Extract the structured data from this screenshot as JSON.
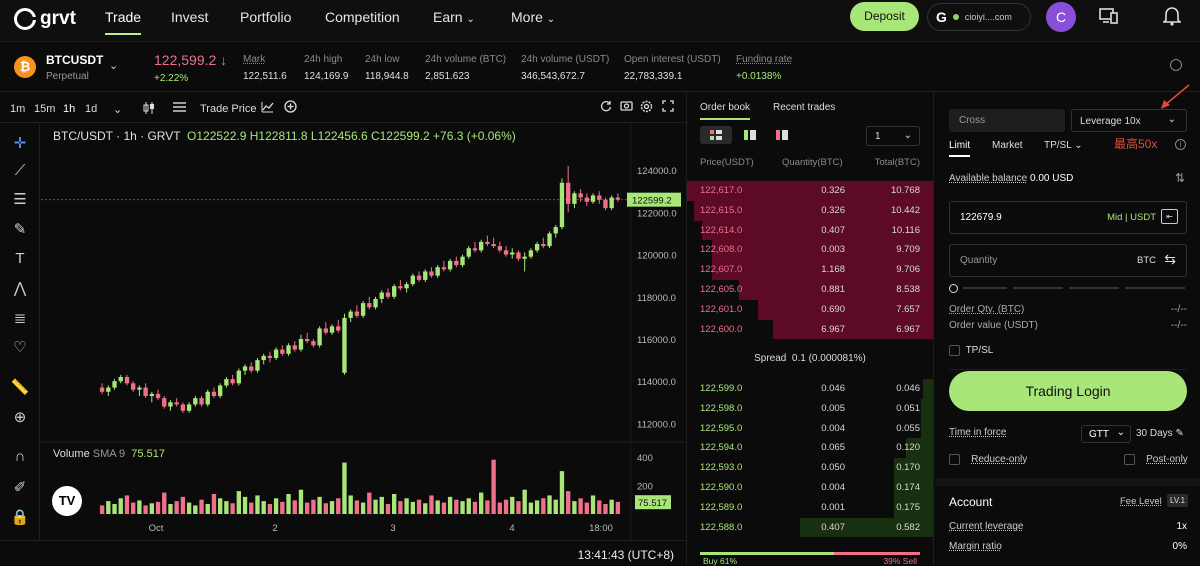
{
  "nav": {
    "logo": "grvt",
    "items": [
      "Trade",
      "Invest",
      "Portfolio",
      "Competition",
      "Earn",
      "More"
    ],
    "deposit": "Deposit",
    "wallet_label": "cioiyi....com",
    "avatar_letter": "C"
  },
  "ticker": {
    "symbol": "BTCUSDT",
    "type": "Perpetual",
    "price": "122,599.2 ↓",
    "change": "+2.22%",
    "stats": [
      {
        "label": "Mark",
        "value": "122,511.6"
      },
      {
        "label": "24h high",
        "value": "124,169.9"
      },
      {
        "label": "24h low",
        "value": "118,944.8"
      },
      {
        "label": "24h volume (BTC)",
        "value": "2,851.623"
      },
      {
        "label": "24h volume (USDT)",
        "value": "346,543,672.7"
      },
      {
        "label": "Open interest (USDT)",
        "value": "22,783,339.1"
      },
      {
        "label": "Funding rate",
        "value": "+0.0138%"
      }
    ]
  },
  "chart_toolbar": {
    "intervals": [
      "1m",
      "15m",
      "1h",
      "1d"
    ],
    "trade_price": "Trade Price"
  },
  "chart": {
    "pair_title": "BTC/USDT · 1h · GRVT",
    "ohlc": "O122522.9  H122811.8  L122456.6  C122599.2  +76.3 (+0.06%)",
    "price_ticks": [
      "124000.0",
      "122000.0",
      "120000.0",
      "118000.0",
      "116000.0",
      "114000.0",
      "112000.0"
    ],
    "last_price_label": "122599.2",
    "volume_title": "Volume",
    "volume_sma": "SMA 9",
    "volume_value": "75.517",
    "volume_ticks": [
      "400",
      "200"
    ],
    "x_ticks": [
      "Oct",
      "2",
      "3",
      "4",
      "18:00"
    ],
    "clock": "13:41:43 (UTC+8)"
  },
  "chart_data": {
    "type": "candlestick",
    "x_ticks": [
      "Oct",
      "2",
      "3",
      "4",
      "18:00"
    ],
    "ylim": [
      111500,
      125000
    ],
    "candles": [
      [
        113700,
        113900,
        113400,
        113500
      ],
      [
        113500,
        113800,
        113300,
        113700
      ],
      [
        113700,
        114100,
        113600,
        114000
      ],
      [
        114000,
        114300,
        113900,
        114200
      ],
      [
        114200,
        114300,
        113800,
        113900
      ],
      [
        113900,
        114000,
        113500,
        113600
      ],
      [
        113600,
        113800,
        113300,
        113700
      ],
      [
        113700,
        113900,
        113200,
        113300
      ],
      [
        113300,
        113500,
        113000,
        113400
      ],
      [
        113400,
        113600,
        113100,
        113200
      ],
      [
        113200,
        113300,
        112700,
        112800
      ],
      [
        112800,
        113100,
        112600,
        113000
      ],
      [
        113000,
        113200,
        112800,
        112900
      ],
      [
        112900,
        113000,
        112500,
        112600
      ],
      [
        112600,
        113000,
        112500,
        112900
      ],
      [
        112900,
        113300,
        112800,
        113200
      ],
      [
        113200,
        113300,
        112800,
        112900
      ],
      [
        112900,
        113600,
        112800,
        113500
      ],
      [
        113500,
        113700,
        113200,
        113300
      ],
      [
        113300,
        113900,
        113200,
        113800
      ],
      [
        113800,
        114200,
        113700,
        114100
      ],
      [
        114100,
        114300,
        113800,
        113900
      ],
      [
        113900,
        114600,
        113800,
        114500
      ],
      [
        114500,
        114800,
        114300,
        114700
      ],
      [
        114700,
        114900,
        114400,
        114500
      ],
      [
        114500,
        115100,
        114400,
        115000
      ],
      [
        115000,
        115300,
        114800,
        115200
      ],
      [
        115200,
        115400,
        114900,
        115100
      ],
      [
        115100,
        115600,
        115000,
        115500
      ],
      [
        115500,
        115700,
        115200,
        115300
      ],
      [
        115300,
        115800,
        115200,
        115700
      ],
      [
        115700,
        115900,
        115400,
        115500
      ],
      [
        115500,
        116200,
        115400,
        116000
      ],
      [
        116000,
        116300,
        115800,
        115900
      ],
      [
        115900,
        116000,
        115600,
        115700
      ],
      [
        115700,
        116600,
        115600,
        116500
      ],
      [
        116500,
        116800,
        116200,
        116300
      ],
      [
        116300,
        116700,
        116200,
        116600
      ],
      [
        116600,
        116900,
        116300,
        116400
      ],
      [
        114400,
        117200,
        114300,
        117000
      ],
      [
        117000,
        117400,
        116800,
        117300
      ],
      [
        117300,
        117600,
        117000,
        117100
      ],
      [
        117100,
        117800,
        117000,
        117700
      ],
      [
        117700,
        118000,
        117400,
        117500
      ],
      [
        117500,
        118000,
        117400,
        117900
      ],
      [
        117900,
        118300,
        117700,
        118200
      ],
      [
        118200,
        118400,
        117900,
        118000
      ],
      [
        118000,
        118600,
        117900,
        118500
      ],
      [
        118500,
        118800,
        118300,
        118400
      ],
      [
        118400,
        118700,
        118200,
        118600
      ],
      [
        118600,
        119100,
        118500,
        119000
      ],
      [
        119000,
        119200,
        118700,
        118800
      ],
      [
        118800,
        119300,
        118700,
        119200
      ],
      [
        119200,
        119400,
        118900,
        119000
      ],
      [
        119000,
        119500,
        118900,
        119400
      ],
      [
        119400,
        119700,
        119200,
        119300
      ],
      [
        119300,
        119800,
        119200,
        119700
      ],
      [
        119700,
        119900,
        119400,
        119500
      ],
      [
        119500,
        120000,
        119400,
        119900
      ],
      [
        119900,
        120400,
        119800,
        120300
      ],
      [
        120300,
        120600,
        120100,
        120200
      ],
      [
        120200,
        120700,
        120100,
        120600
      ],
      [
        120600,
        120900,
        120400,
        120500
      ],
      [
        120500,
        120800,
        120300,
        120400
      ],
      [
        120400,
        120600,
        120100,
        120200
      ],
      [
        120200,
        120400,
        119900,
        120000
      ],
      [
        120000,
        120300,
        119800,
        120100
      ],
      [
        120100,
        120200,
        119700,
        119800
      ],
      [
        119800,
        120100,
        119200,
        119900
      ],
      [
        119900,
        120300,
        119800,
        120200
      ],
      [
        120200,
        120600,
        120100,
        120500
      ],
      [
        120500,
        120800,
        120300,
        120400
      ],
      [
        120400,
        121100,
        120300,
        121000
      ],
      [
        121000,
        121400,
        120800,
        121300
      ],
      [
        121300,
        123600,
        121200,
        123400
      ],
      [
        123400,
        124200,
        122000,
        122400
      ],
      [
        122400,
        123000,
        122200,
        122900
      ],
      [
        122900,
        123100,
        122500,
        122700
      ],
      [
        122700,
        122900,
        122300,
        122500
      ],
      [
        122500,
        122900,
        122400,
        122800
      ],
      [
        122800,
        123000,
        122400,
        122600
      ],
      [
        122600,
        122700,
        122100,
        122200
      ],
      [
        122200,
        122800,
        122100,
        122700
      ],
      [
        122700,
        122900,
        122500,
        122600
      ]
    ],
    "volume": [
      60,
      90,
      70,
      110,
      130,
      80,
      95,
      60,
      75,
      85,
      150,
      70,
      90,
      120,
      80,
      60,
      100,
      70,
      140,
      110,
      90,
      75,
      160,
      120,
      80,
      130,
      90,
      70,
      110,
      85,
      140,
      95,
      170,
      80,
      100,
      120,
      75,
      90,
      110,
      360,
      130,
      95,
      80,
      150,
      100,
      120,
      70,
      140,
      90,
      110,
      85,
      100,
      75,
      130,
      95,
      80,
      120,
      100,
      90,
      110,
      85,
      150,
      95,
      380,
      80,
      100,
      120,
      90,
      170,
      80,
      95,
      110,
      130,
      100,
      300,
      160,
      90,
      110,
      80,
      130,
      95,
      70,
      100,
      85
    ]
  },
  "orderbook": {
    "tabs": [
      "Order book",
      "Recent trades"
    ],
    "step": "1",
    "headers": [
      "Price(USDT)",
      "Quantity(BTC)",
      "Total(BTC)"
    ],
    "asks": [
      {
        "p": "122,617.0",
        "q": "0.326",
        "t": "10.768",
        "depth": 1.0
      },
      {
        "p": "122,615.0",
        "q": "0.326",
        "t": "10.442",
        "depth": 0.97
      },
      {
        "p": "122,614.0",
        "q": "0.407",
        "t": "10.116",
        "depth": 0.94
      },
      {
        "p": "122,608.0",
        "q": "0.003",
        "t": "9.709",
        "depth": 0.9
      },
      {
        "p": "122,607.0",
        "q": "1.168",
        "t": "9.706",
        "depth": 0.9
      },
      {
        "p": "122,605.0",
        "q": "0.881",
        "t": "8.538",
        "depth": 0.79
      },
      {
        "p": "122,601.0",
        "q": "0.690",
        "t": "7.657",
        "depth": 0.71
      },
      {
        "p": "122,600.0",
        "q": "6.967",
        "t": "6.967",
        "depth": 0.65
      }
    ],
    "spread_label": "Spread",
    "spread_value": "0.1 (0.000081%)",
    "bids": [
      {
        "p": "122,599.0",
        "q": "0.046",
        "t": "0.046",
        "depth": 0.04
      },
      {
        "p": "122,598.0",
        "q": "0.005",
        "t": "0.051",
        "depth": 0.05
      },
      {
        "p": "122,595.0",
        "q": "0.004",
        "t": "0.055",
        "depth": 0.05
      },
      {
        "p": "122,594.0",
        "q": "0.065",
        "t": "0.120",
        "depth": 0.11
      },
      {
        "p": "122,593.0",
        "q": "0.050",
        "t": "0.170",
        "depth": 0.16
      },
      {
        "p": "122,590.0",
        "q": "0.004",
        "t": "0.174",
        "depth": 0.16
      },
      {
        "p": "122,589.0",
        "q": "0.001",
        "t": "0.175",
        "depth": 0.16
      },
      {
        "p": "122,588.0",
        "q": "0.407",
        "t": "0.582",
        "depth": 0.54
      }
    ],
    "buy_pct": "Buy 61%",
    "sell_pct": "39% Sell",
    "buy_ratio": 0.61
  },
  "panel": {
    "margin_mode": "Cross",
    "leverage": "Leverage 10x",
    "max_note": "最高50x",
    "order_types": [
      "Limit",
      "Market",
      "TP/SL"
    ],
    "available_label": "Available balance",
    "available_value": "0.00 USD",
    "price_value": "122679.9",
    "price_suffix": "Mid | USDT",
    "qty_placeholder": "Quantity",
    "qty_unit": "BTC",
    "order_qty_label": "Order Qty. (BTC)",
    "order_qty_value": "--/--",
    "order_value_label": "Order value (USDT)",
    "order_value_value": "--/--",
    "tpsl_label": "TP/SL",
    "login": "Trading Login",
    "tif_label": "Time in force",
    "tif_value": "GTT",
    "tif_days": "30 Days",
    "reduce_only": "Reduce-only",
    "post_only": "Post-only",
    "account_title": "Account",
    "fee_level": "Fee Level",
    "fee_badge": "LV.1",
    "cur_lev_label": "Current leverage",
    "cur_lev_value": "1x",
    "margin_ratio_label": "Margin ratio",
    "margin_ratio_value": "0%"
  },
  "colors": {
    "accent": "#a8e67a",
    "ask": "#f0708a",
    "bid": "#a8e67a",
    "arrow": "#e04a3a"
  }
}
